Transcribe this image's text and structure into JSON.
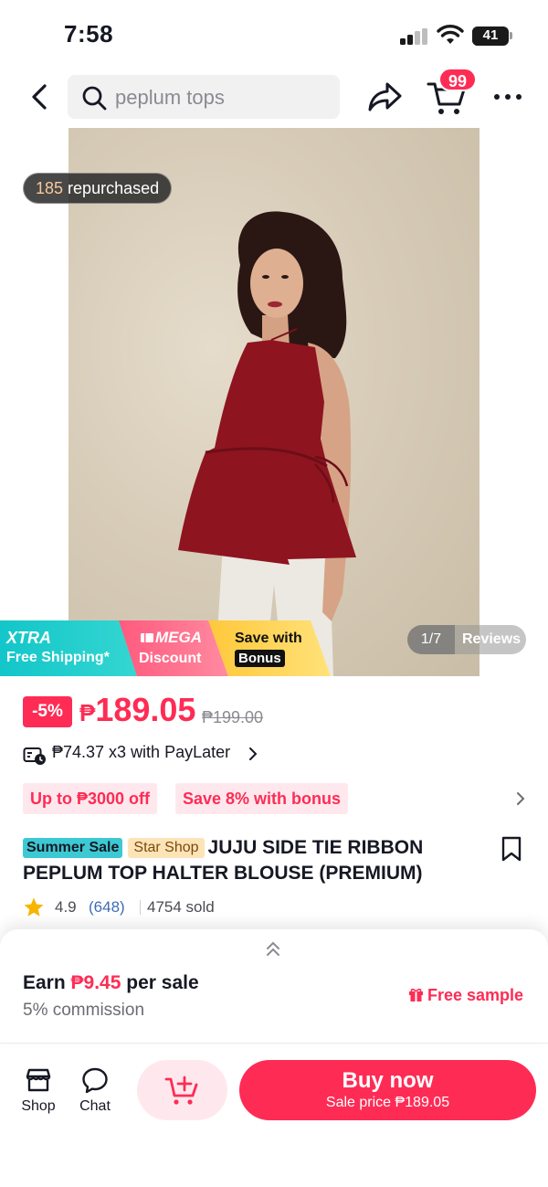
{
  "status_bar": {
    "time": "7:58",
    "battery": "41",
    "battery_level": 0.41
  },
  "header": {
    "search_text": "peplum tops",
    "cart_badge": "99"
  },
  "gallery": {
    "repurchased_count": "185",
    "repurchased_label": " repurchased",
    "page_counter": "1/7",
    "reviews_label": "Reviews"
  },
  "promos": {
    "xtra_line1": "XTRA",
    "xtra_line2": "Free Shipping*",
    "mega_line1": "MEGA",
    "mega_line2": "Discount",
    "bonus_line1": "Save with",
    "bonus_line2": "Bonus"
  },
  "pricing": {
    "discount": "-5%",
    "currency": "₱",
    "price": "189.05",
    "original_price": "₱199.00",
    "paylater": "₱74.37 x3 with PayLater"
  },
  "vouchers": [
    "Up to ₱3000 off",
    "Save 8% with bonus"
  ],
  "product": {
    "tag_sale": "Summer Sale",
    "tag_shop": "Star Shop",
    "title": "JUJU SIDE TIE RIBBON PEPLUM TOP HALTER BLOUSE (PREMIUM)",
    "rating": "4.9",
    "review_count": "(648)",
    "sold": "4754 sold"
  },
  "affiliate": {
    "earn_prefix": "Earn ",
    "earn_amount": "₱9.45",
    "earn_suffix": " per sale",
    "commission": "5% commission",
    "free_sample": "Free sample"
  },
  "bottom_bar": {
    "shop_label": "Shop",
    "chat_label": "Chat",
    "buy_label": "Buy now",
    "sale_price": "Sale price ₱189.05"
  },
  "colors": {
    "accent": "#fe2c55",
    "accent_light": "#ffe8ed",
    "xtra_teal": "#13c6c9",
    "mega_pink": "#ff5a7e",
    "bonus_yellow": "#ffc83a",
    "link_blue": "#3f6cb5",
    "star_gold": "#f7b500",
    "blouse_red": "#8e1420"
  },
  "icons": {
    "back": "chevron-left-icon",
    "search": "search-icon",
    "share": "share-arrow-icon",
    "cart": "cart-icon",
    "more": "more-dots-icon",
    "bookmark": "bookmark-icon",
    "star": "star-icon",
    "gift": "gift-icon",
    "shop": "shop-icon",
    "chat": "chat-bubble-icon",
    "add_to_cart": "cart-plus-icon"
  }
}
